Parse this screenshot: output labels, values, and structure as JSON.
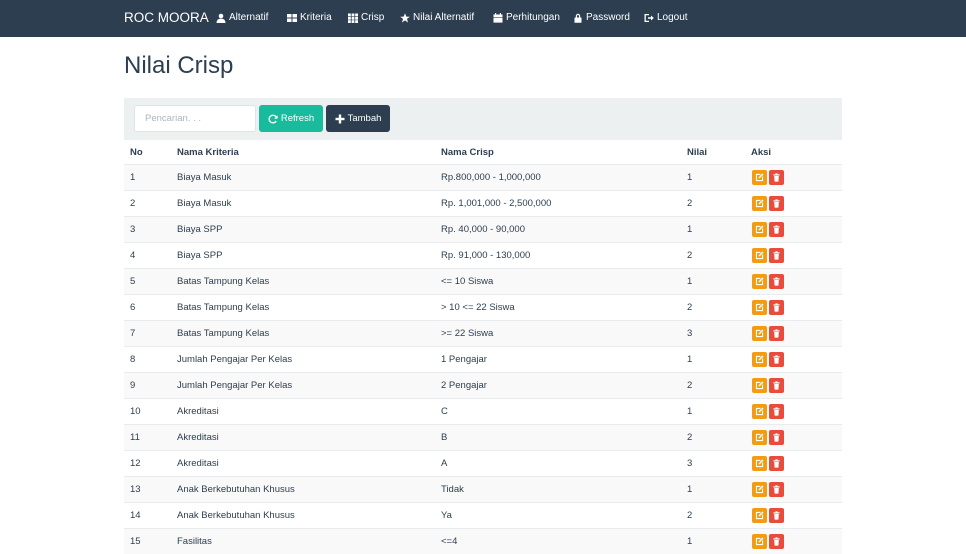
{
  "nav": {
    "brand": "ROC MOORA",
    "items": [
      {
        "label": "Alternatif",
        "icon": "user-icon"
      },
      {
        "label": "Kriteria",
        "icon": "table-icon"
      },
      {
        "label": "Crisp",
        "icon": "grid-icon"
      },
      {
        "label": "Nilai Alternatif",
        "icon": "star-icon"
      },
      {
        "label": "Perhitungan",
        "icon": "calendar-icon"
      },
      {
        "label": "Password",
        "icon": "lock-icon"
      },
      {
        "label": "Logout",
        "icon": "logout-icon"
      }
    ]
  },
  "page": {
    "title": "Nilai Crisp"
  },
  "toolbar": {
    "search_placeholder": "Pencarian. . .",
    "search_value": "",
    "refresh_label": "Refresh",
    "tambah_label": "Tambah"
  },
  "table": {
    "headers": {
      "no": "No",
      "kriteria": "Nama Kriteria",
      "crisp": "Nama Crisp",
      "nilai": "Nilai",
      "aksi": "Aksi"
    },
    "rows": [
      {
        "no": "1",
        "kriteria": "Biaya Masuk",
        "crisp": "Rp.800,000 - 1,000,000",
        "nilai": "1"
      },
      {
        "no": "2",
        "kriteria": "Biaya Masuk",
        "crisp": "Rp. 1,001,000 - 2,500,000",
        "nilai": "2"
      },
      {
        "no": "3",
        "kriteria": "Biaya SPP",
        "crisp": "Rp. 40,000 - 90,000",
        "nilai": "1"
      },
      {
        "no": "4",
        "kriteria": "Biaya SPP",
        "crisp": "Rp. 91,000 - 130,000",
        "nilai": "2"
      },
      {
        "no": "5",
        "kriteria": "Batas Tampung Kelas",
        "crisp": "<= 10 Siswa",
        "nilai": "1"
      },
      {
        "no": "6",
        "kriteria": "Batas Tampung Kelas",
        "crisp": "> 10 <= 22 Siswa",
        "nilai": "2"
      },
      {
        "no": "7",
        "kriteria": "Batas Tampung Kelas",
        "crisp": ">= 22 Siswa",
        "nilai": "3"
      },
      {
        "no": "8",
        "kriteria": "Jumlah Pengajar Per Kelas",
        "crisp": "1 Pengajar",
        "nilai": "1"
      },
      {
        "no": "9",
        "kriteria": "Jumlah Pengajar Per Kelas",
        "crisp": "2 Pengajar",
        "nilai": "2"
      },
      {
        "no": "10",
        "kriteria": "Akreditasi",
        "crisp": "C",
        "nilai": "1"
      },
      {
        "no": "11",
        "kriteria": "Akreditasi",
        "crisp": "B",
        "nilai": "2"
      },
      {
        "no": "12",
        "kriteria": "Akreditasi",
        "crisp": "A",
        "nilai": "3"
      },
      {
        "no": "13",
        "kriteria": "Anak Berkebutuhan Khusus",
        "crisp": "Tidak",
        "nilai": "1"
      },
      {
        "no": "14",
        "kriteria": "Anak Berkebutuhan Khusus",
        "crisp": "Ya",
        "nilai": "2"
      },
      {
        "no": "15",
        "kriteria": "Fasilitas",
        "crisp": "<=4",
        "nilai": "1"
      }
    ]
  },
  "colors": {
    "navbar": "#2c3e50",
    "refresh": "#18bc9c",
    "edit": "#f39c12",
    "delete": "#e74c3c"
  }
}
